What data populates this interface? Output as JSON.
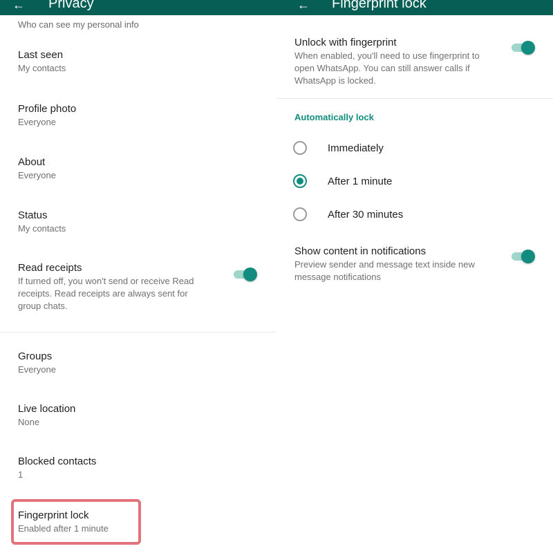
{
  "left_header": {
    "back_icon": "arrow-left-icon",
    "title": "Privacy"
  },
  "right_header": {
    "back_icon": "arrow-left-icon",
    "title": "Fingerprint lock"
  },
  "privacy": {
    "top_clipped_subtitle": "Who can see my personal info",
    "items": [
      {
        "title": "Last seen",
        "subtitle": "My contacts"
      },
      {
        "title": "Profile photo",
        "subtitle": "Everyone"
      },
      {
        "title": "About",
        "subtitle": "Everyone"
      },
      {
        "title": "Status",
        "subtitle": "My contacts"
      },
      {
        "title": "Read receipts",
        "subtitle": "If turned off, you won't send or receive Read receipts. Read receipts are always sent for group chats."
      },
      {
        "title": "Groups",
        "subtitle": "Everyone"
      },
      {
        "title": "Live location",
        "subtitle": "None"
      },
      {
        "title": "Blocked contacts",
        "subtitle": "1"
      },
      {
        "title": "Fingerprint lock",
        "subtitle": "Enabled after 1 minute"
      }
    ],
    "read_receipts_toggle": true
  },
  "fingerprint": {
    "unlock_title": "Unlock with fingerprint",
    "unlock_subtitle": "When enabled, you'll need to use fingerprint to open WhatsApp. You can still answer calls if WhatsApp is locked.",
    "unlock_toggle": true,
    "auto_lock_label": "Automatically lock",
    "options": [
      {
        "label": "Immediately",
        "checked": false
      },
      {
        "label": "After 1 minute",
        "checked": true
      },
      {
        "label": "After 30 minutes",
        "checked": false
      }
    ],
    "show_content_title": "Show content in notifications",
    "show_content_subtitle": "Preview sender and message text inside new message notifications",
    "show_content_toggle": true
  },
  "colors": {
    "header": "#075e54",
    "accent": "#128c7e",
    "highlight": "#e2737c"
  }
}
